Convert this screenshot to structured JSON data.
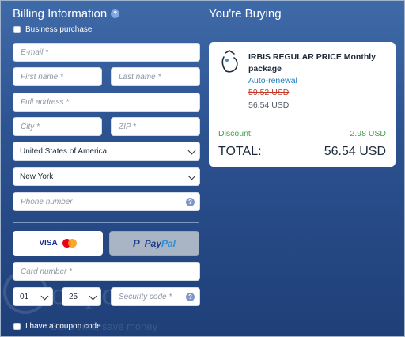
{
  "billing": {
    "title": "Billing Information",
    "business_purchase": "Business purchase",
    "fields": {
      "email": "E-mail *",
      "first_name": "First name *",
      "last_name": "Last name *",
      "address": "Full address *",
      "city": "City *",
      "zip": "ZIP *",
      "phone": "Phone number"
    },
    "country": "United States of America",
    "state": "New York"
  },
  "payment": {
    "visa_label": "VISA",
    "paypal_pay": "Pay",
    "paypal_pal": "Pal",
    "card_number": "Card number *",
    "month": "01",
    "year": "25",
    "security_code": "Security code *",
    "coupon_label": "I have a coupon code"
  },
  "watermark": {
    "word": "oupon",
    "tagline": "Save time, save money"
  },
  "summary": {
    "title": "You're Buying",
    "product_name": "IRBIS REGULAR PRICE Monthly package",
    "renewal": "Auto-renewal",
    "old_price": "59.52 USD",
    "new_price": "56.54 USD",
    "discount_label": "Discount:",
    "discount_value": "2.98 USD",
    "total_label": "TOTAL:",
    "total_value": "56.54 USD"
  },
  "colors": {
    "background_top": "#3f6aa8",
    "background_bottom": "#1f3f78",
    "discount_green": "#3aa54a",
    "link_blue": "#1e7db8",
    "strike_red": "#c0392b"
  },
  "icons": [
    "help-icon",
    "chevron-down-icon",
    "mastercard-icon",
    "paypal-icon",
    "product-icon",
    "coupon-logo"
  ]
}
